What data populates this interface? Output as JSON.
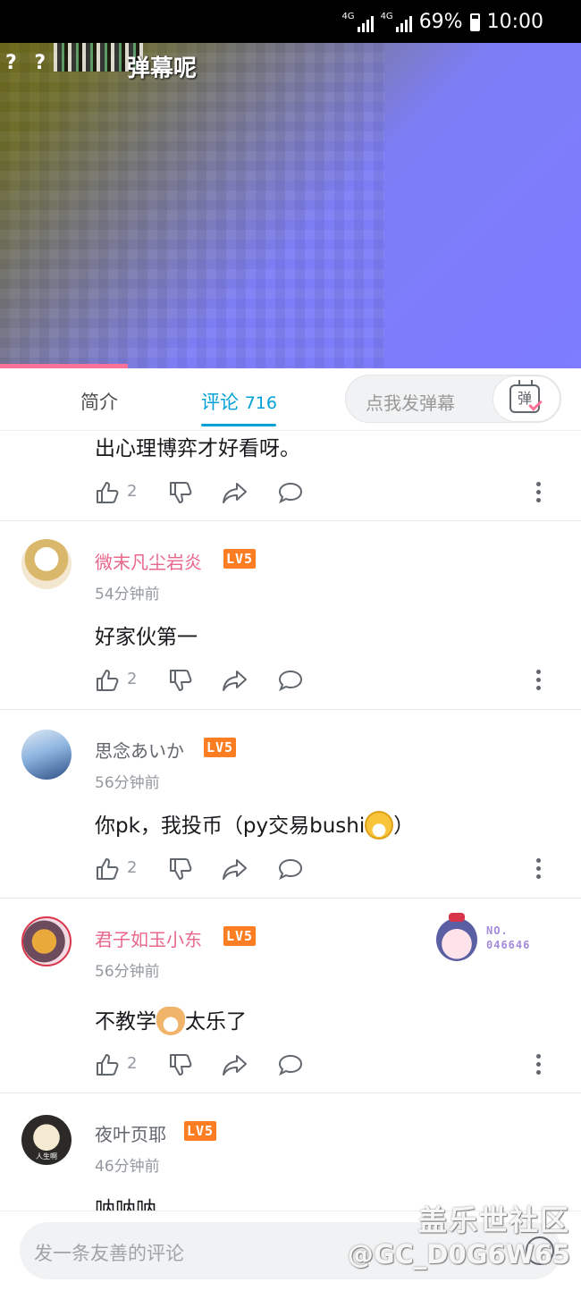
{
  "status_bar": {
    "net1": "4G",
    "net2": "4G",
    "battery": "69%",
    "time": "10:00"
  },
  "video": {
    "overlay_marks": "? ?",
    "danmaku_text": "弹幕呢",
    "progress": 0.22
  },
  "tabs": {
    "intro": "简介",
    "comments_label": "评论",
    "comments_count": "716"
  },
  "danmaku_input": {
    "placeholder": "点我发弹幕",
    "button_icon": "弹",
    "button_icon_name": "danmaku-tv-icon"
  },
  "comments": [
    {
      "text": "出心理博弈才好看呀。",
      "likes": "2"
    },
    {
      "user": "微末凡尘岩炎",
      "level": "LV5",
      "time": "54分钟前",
      "text": "好家伙第一",
      "likes": "2",
      "name_color": "#e8678a"
    },
    {
      "user": "思念あいか",
      "level": "LV5",
      "time": "56分钟前",
      "text_before": "你pk，我投币（py交易bushi",
      "emoji": "mask-face-emoji",
      "text_after": "）",
      "likes": "2"
    },
    {
      "user": "君子如玉小东",
      "level": "LV5",
      "time": "56分钟前",
      "text_before": "不教学",
      "emoji": "shiba-laugh-emoji",
      "text_after": "太乐了",
      "likes": "2",
      "fan_badge": {
        "no_label": "NO.",
        "no_value": "046646"
      },
      "name_color": "#e8678a"
    },
    {
      "user": "夜叶页耶",
      "level": "LV5",
      "time": "46分钟前",
      "text": "呐呐呐",
      "avatar_text": "人生啊"
    }
  ],
  "bottom_input": {
    "placeholder": "发一条友善的评论"
  },
  "watermark": {
    "line1": "盖乐世社区",
    "line2": "@GC_D0G6W65"
  },
  "colors": {
    "accent": "#00a1d6",
    "pink": "#fb7299",
    "level_badge": "#fd7e22"
  }
}
